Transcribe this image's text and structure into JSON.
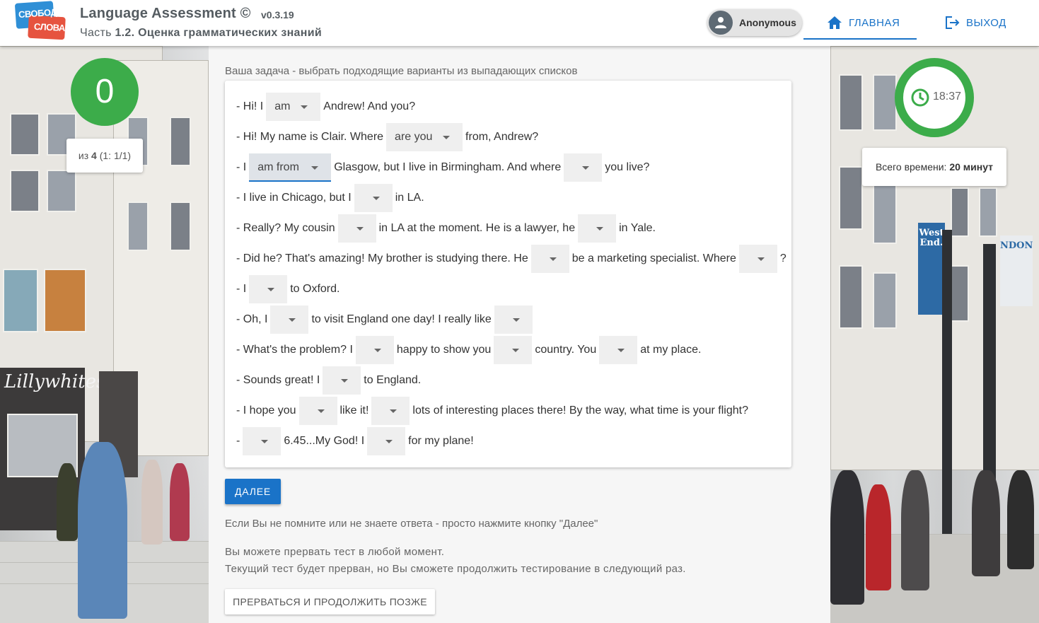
{
  "header": {
    "logo_top": "СВОБОДА",
    "logo_bottom": "СЛОВА",
    "app_title": "Language Assessment ©",
    "version": "v0.3.19",
    "part_prefix": "Часть ",
    "part_title": "1.2. Оценка грамматических знаний",
    "user_name": "Anonymous",
    "nav_home": "ГЛАВНАЯ",
    "nav_exit": "ВЫХОД"
  },
  "score": {
    "value": "0",
    "progress_prefix": "из ",
    "progress_total": "4",
    "progress_detail": " (1: 1/1)"
  },
  "timer": {
    "remaining": "18:37",
    "remaining_fraction": 0.93,
    "total_label": "Всего времени: ",
    "total_value": "20 минут"
  },
  "task": {
    "instruction": "Ваша задача - выбрать подходящие варианты из выпадающих списков",
    "lines": [
      [
        "- Hi! I",
        {
          "sel": "am"
        },
        "Andrew! And you?"
      ],
      [
        "- Hi! My name is Clair. Where",
        {
          "sel": "are you"
        },
        "from, Andrew?"
      ],
      [
        "- I",
        {
          "sel": "am from",
          "focused": true
        },
        "Glasgow, but I live in Birmingham. And where",
        {
          "sel": ""
        },
        "you live?"
      ],
      [
        "- I live in Chicago, but I",
        {
          "sel": ""
        },
        "in LA."
      ],
      [
        "- Really? My cousin",
        {
          "sel": ""
        },
        "in LA at the moment. He is a lawyer, he",
        {
          "sel": ""
        },
        "in Yale."
      ],
      [
        "- Did he? That's amazing! My brother is studying there. He",
        {
          "sel": ""
        },
        "be a marketing specialist. Where",
        {
          "sel": ""
        },
        "?"
      ],
      [
        "- I",
        {
          "sel": ""
        },
        "to Oxford."
      ],
      [
        "- Oh, I",
        {
          "sel": ""
        },
        "to visit England one day! I really like",
        {
          "sel": ""
        }
      ],
      [
        "- What's the problem? I",
        {
          "sel": ""
        },
        "happy to show you",
        {
          "sel": ""
        },
        "country. You",
        {
          "sel": ""
        },
        "at my place."
      ],
      [
        "- Sounds great! I",
        {
          "sel": ""
        },
        "to England."
      ],
      [
        "- I hope you",
        {
          "sel": ""
        },
        "like it!",
        {
          "sel": ""
        },
        "lots of interesting places there! By the way, what time is your flight?"
      ],
      [
        "-",
        {
          "sel": ""
        },
        "6.45...My God! I",
        {
          "sel": ""
        },
        "for my plane!"
      ]
    ]
  },
  "actions": {
    "next": "ДАЛЕЕ",
    "hint": "Если Вы не помните или не знаете ответа - просто нажмите кнопку \"Далее\"",
    "info_line1": "Вы можете прервать тест в любой момент.",
    "info_line2": "Текущий тест будет прерван, но Вы сможете продолжить тестирование в следующий раз.",
    "pause": "ПРЕРВАТЬСЯ И ПРОДОЛЖИТЬ ПОЗЖЕ"
  },
  "colors": {
    "accent": "#1a73c8",
    "score_green": "#3cac4a"
  }
}
